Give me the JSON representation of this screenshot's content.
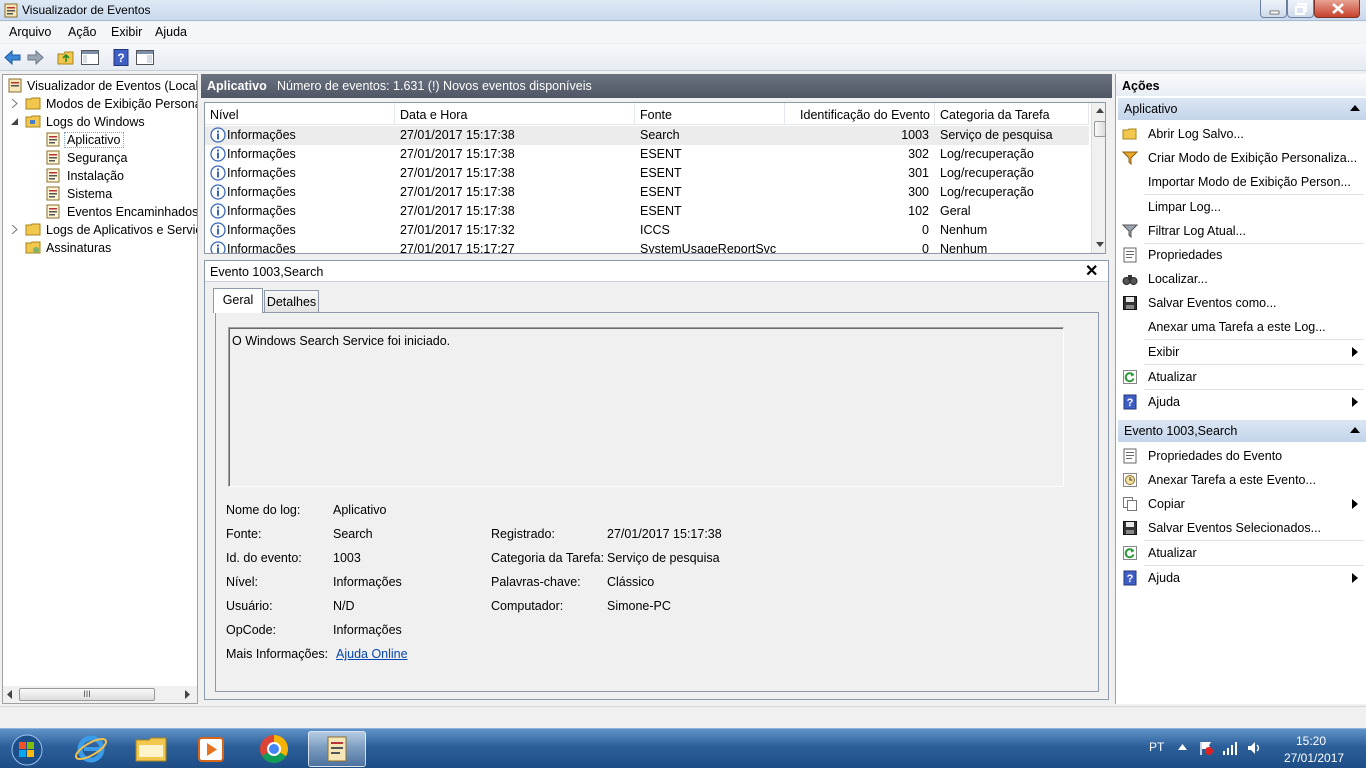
{
  "window": {
    "title": "Visualizador de Eventos"
  },
  "menu": [
    "Arquivo",
    "Ação",
    "Exibir",
    "Ajuda"
  ],
  "tree": {
    "root": "Visualizador de Eventos (Local)",
    "custom_views": "Modos de Exibição Personali",
    "windows_logs": "Logs do Windows",
    "logs": [
      "Aplicativo",
      "Segurança",
      "Instalação",
      "Sistema",
      "Eventos Encaminhados"
    ],
    "app_services": "Logs de Aplicativos e Serviço",
    "subscriptions": "Assinaturas",
    "scroll_grip": "III"
  },
  "center": {
    "title": "Aplicativo",
    "summary": "Número de eventos: 1.631 (!) Novos eventos disponíveis"
  },
  "grid": {
    "headers": [
      "Nível",
      "Data e Hora",
      "Fonte",
      "Identificação do Evento",
      "Categoria da Tarefa"
    ],
    "rows": [
      {
        "level": "Informações",
        "date": "27/01/2017 15:17:38",
        "source": "Search",
        "id": "1003",
        "category": "Serviço de pesquisa"
      },
      {
        "level": "Informações",
        "date": "27/01/2017 15:17:38",
        "source": "ESENT",
        "id": "302",
        "category": "Log/recuperação"
      },
      {
        "level": "Informações",
        "date": "27/01/2017 15:17:38",
        "source": "ESENT",
        "id": "301",
        "category": "Log/recuperação"
      },
      {
        "level": "Informações",
        "date": "27/01/2017 15:17:38",
        "source": "ESENT",
        "id": "300",
        "category": "Log/recuperação"
      },
      {
        "level": "Informações",
        "date": "27/01/2017 15:17:38",
        "source": "ESENT",
        "id": "102",
        "category": "Geral"
      },
      {
        "level": "Informações",
        "date": "27/01/2017 15:17:32",
        "source": "ICCS",
        "id": "0",
        "category": "Nenhum"
      },
      {
        "level": "Informações",
        "date": "27/01/2017 15:17:27",
        "source": "SystemUsageReportSvc",
        "id": "0",
        "category": "Nenhum"
      }
    ]
  },
  "detail": {
    "title": "Evento 1003,Search",
    "close": "✕",
    "tabs": [
      "Geral",
      "Detalhes"
    ],
    "message": "O Windows Search Service foi iniciado.",
    "fields": {
      "log_name_label": "Nome do log:",
      "log_name": "Aplicativo",
      "source_label": "Fonte:",
      "source": "Search",
      "logged_label": "Registrado:",
      "logged": "27/01/2017 15:17:38",
      "event_id_label": "Id. do evento:",
      "event_id": "1003",
      "task_label": "Categoria da Tarefa:",
      "task": "Serviço de pesquisa",
      "level_label": "Nível:",
      "level": "Informações",
      "keywords_label": "Palavras-chave:",
      "keywords": "Clássico",
      "user_label": "Usuário:",
      "user": "N/D",
      "computer_label": "Computador:",
      "computer": "Simone-PC",
      "opcode_label": "OpCode:",
      "opcode": "Informações",
      "more_info_label": "Mais Informações:",
      "more_info": "Ajuda Online"
    }
  },
  "actions": {
    "title": "Ações",
    "group1": "Aplicativo",
    "group1_items": [
      "Abrir Log Salvo...",
      "Criar Modo de Exibição Personaliza...",
      "Importar Modo de Exibição Person...",
      "Limpar Log...",
      "Filtrar Log Atual...",
      "Propriedades",
      "Localizar...",
      "Salvar Eventos como...",
      "Anexar uma Tarefa a este Log...",
      "Exibir",
      "Atualizar",
      "Ajuda"
    ],
    "group2": "Evento 1003,Search",
    "group2_items": [
      "Propriedades do Evento",
      "Anexar Tarefa a este Evento...",
      "Copiar",
      "Salvar Eventos Selecionados...",
      "Atualizar",
      "Ajuda"
    ]
  },
  "taskbar": {
    "lang": "PT",
    "time": "15:20",
    "date": "27/01/2017",
    "pinned_icons": [
      "start-orb-icon",
      "internet-explorer-icon",
      "file-explorer-icon",
      "media-player-icon",
      "chrome-icon",
      "event-viewer-icon"
    ]
  },
  "colors": {
    "header_bar": "#5a6171",
    "action_group": "#cad9ec",
    "taskbar": "#2c5f99",
    "link": "#0645ad"
  }
}
